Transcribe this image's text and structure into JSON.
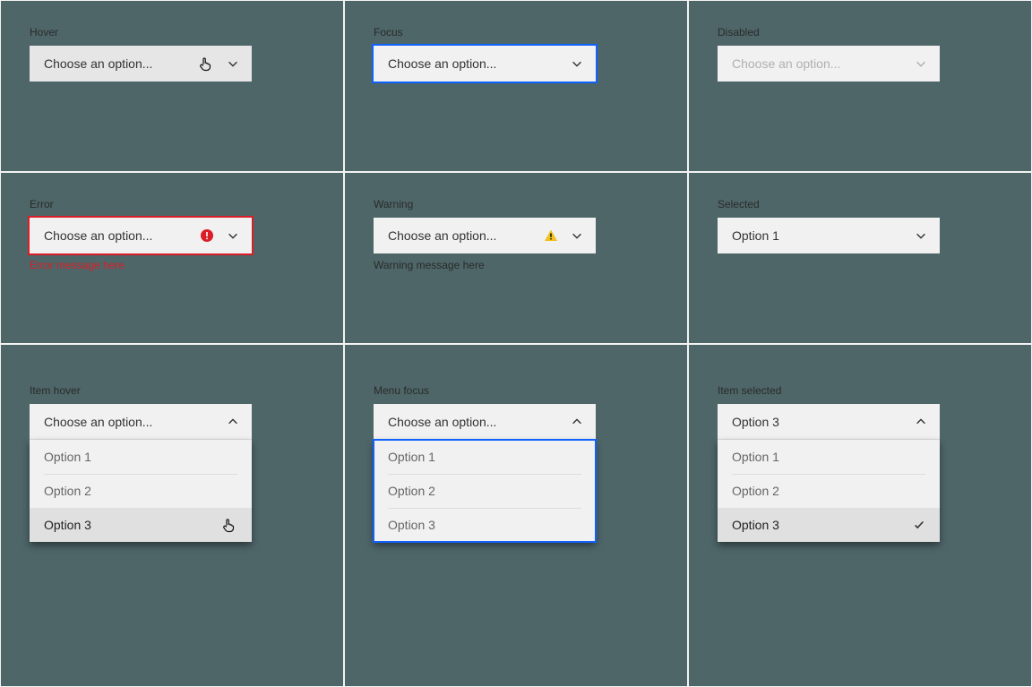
{
  "states": {
    "hover": {
      "label": "Hover",
      "text": "Choose an option..."
    },
    "focus": {
      "label": "Focus",
      "text": "Choose an option..."
    },
    "disabled": {
      "label": "Disabled",
      "text": "Choose an option..."
    },
    "error": {
      "label": "Error",
      "text": "Choose an option...",
      "help": "Error message here"
    },
    "warning": {
      "label": "Warning",
      "text": "Choose an option...",
      "help": "Warning message here"
    },
    "selected": {
      "label": "Selected",
      "text": "Option 1"
    },
    "item_hover": {
      "label": "Item hover",
      "header": "Choose an option..."
    },
    "menu_focus": {
      "label": "Menu focus",
      "header": "Choose an option..."
    },
    "item_selected": {
      "label": "Item selected",
      "header": "Option 3"
    }
  },
  "options": [
    "Option 1",
    "Option 2",
    "Option 3"
  ]
}
